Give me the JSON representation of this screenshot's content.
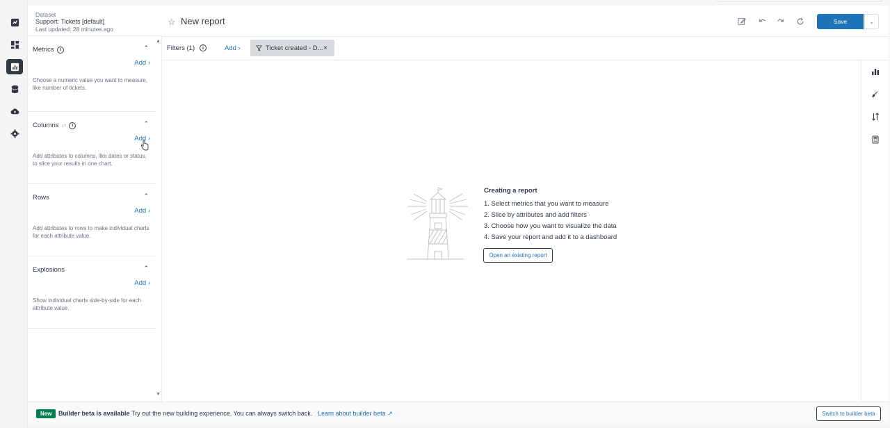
{
  "dataset": {
    "label": "Dataset",
    "name": "Support: Tickets [default]",
    "updated": "Last updated: 28 minutes ago"
  },
  "report": {
    "title": "New report",
    "save_label": "Save"
  },
  "sections": {
    "metrics": {
      "title": "Metrics",
      "add": "Add ›",
      "desc": "Choose a numeric value you want to measure, like number of tickets."
    },
    "columns": {
      "title": "Columns",
      "add": "Add ›",
      "desc": "Add attributes to columns, like dates or status, to slice your results in one chart."
    },
    "rows": {
      "title": "Rows",
      "add": "Add ›",
      "desc": "Add attributes to rows to make individual charts for each attribute value."
    },
    "explosions": {
      "title": "Explosions",
      "add": "Add ›",
      "desc": "Show individual charts side-by-side for each attribute value."
    }
  },
  "filters": {
    "label": "Filters (1)",
    "add": "Add ›",
    "chip": "Ticket created - D..."
  },
  "empty_state": {
    "heading": "Creating a report",
    "steps": [
      "1. Select metrics that you want to measure",
      "2. Slice by attributes and add filters",
      "3. Choose how you want to visualize the data",
      "4. Save your report and add it to a dashboard"
    ],
    "open_button": "Open an existing report"
  },
  "banner": {
    "badge": "New",
    "title": "Builder beta is available",
    "text": "Try out the new building experience. You can always switch back.",
    "link": "Learn about builder beta",
    "switch_button": "Switch to builder beta"
  },
  "colors": {
    "accent": "#1f73b7",
    "new_badge": "#037f52",
    "chip_bg": "#d8dcde"
  }
}
